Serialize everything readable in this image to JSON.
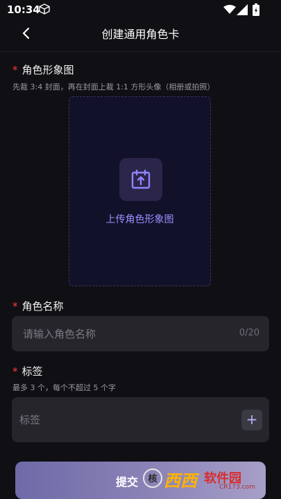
{
  "status": {
    "time": "10:34"
  },
  "header": {
    "title": "创建通用角色卡"
  },
  "image_section": {
    "required_mark": "*",
    "title": "角色形象图",
    "hint": "先裁 3:4 封面，再在封面上裁 1:1 方形头像（相册或拍照）",
    "upload_label": "上传角色形象图"
  },
  "name_section": {
    "required_mark": "*",
    "title": "角色名称",
    "placeholder": "请输入角色名称",
    "counter": "0/20"
  },
  "tags_section": {
    "required_mark": "*",
    "title": "标签",
    "hint": "最多 3 个，每个不超过 5 个字",
    "placeholder": "标签",
    "add_symbol": "+"
  },
  "footer": {
    "submit_label": "提交"
  },
  "watermark": {
    "circle": "核",
    "brand": "西西",
    "brand_b": "软件园",
    "url": "CR173.com"
  },
  "colors": {
    "background": "#0f0f14",
    "accent": "#9b90ff",
    "required": "#ff3b3b",
    "input_bg": "#25252b"
  }
}
